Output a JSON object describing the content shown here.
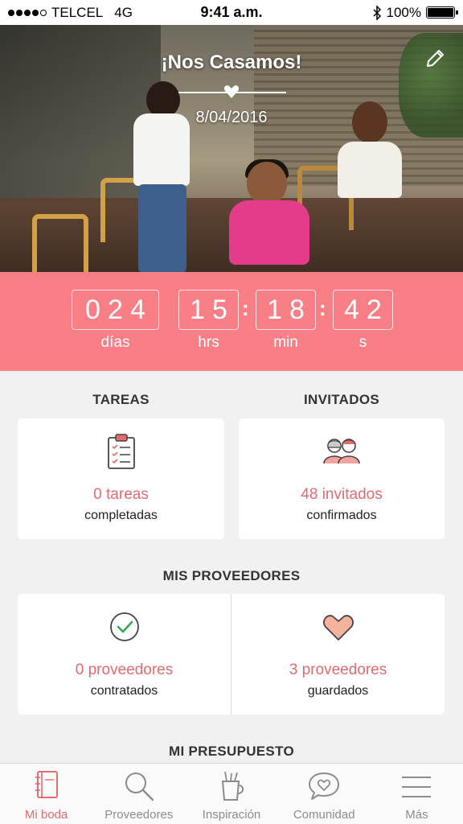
{
  "status_bar": {
    "carrier": "TELCEL",
    "network": "4G",
    "time": "9:41 a.m.",
    "battery": "100%",
    "battery_level": 1.0
  },
  "hero": {
    "title": "¡Nos Casamos!",
    "date": "8/04/2016",
    "icons": {
      "heart": "heart-icon",
      "edit": "pencil-icon"
    }
  },
  "countdown": {
    "days": [
      "0",
      "2",
      "4"
    ],
    "hours": [
      "1",
      "5"
    ],
    "minutes": [
      "1",
      "8"
    ],
    "seconds": [
      "4",
      "2"
    ],
    "labels": {
      "days": "días",
      "hours": "hrs",
      "minutes": "min",
      "seconds": "s"
    }
  },
  "tasks": {
    "title": "TAREAS",
    "count": "0 tareas",
    "sub": "completadas",
    "icon": "clipboard-checklist-icon"
  },
  "guests": {
    "title": "INVITADOS",
    "count": "48 invitados",
    "sub": "confirmados",
    "icon": "guests-icon"
  },
  "vendors": {
    "title": "MIS PROVEEDORES",
    "hired": {
      "count": "0 proveedores",
      "sub": "contratados",
      "icon": "check-circle-icon"
    },
    "saved": {
      "count": "3 proveedores",
      "sub": "guardados",
      "icon": "heart-icon"
    }
  },
  "budget": {
    "title": "MI PRESUPUESTO"
  },
  "tabs": [
    {
      "label": "Mi boda",
      "icon": "notebook-icon",
      "active": true
    },
    {
      "label": "Proveedores",
      "icon": "search-icon",
      "active": false
    },
    {
      "label": "Inspiración",
      "icon": "craft-cup-icon",
      "active": false
    },
    {
      "label": "Comunidad",
      "icon": "chat-heart-icon",
      "active": false
    },
    {
      "label": "Más",
      "icon": "menu-icon",
      "active": false
    }
  ],
  "colors": {
    "accent": "#f87f86",
    "accent_text": "#e36a6e",
    "background": "#f1f1f1"
  }
}
